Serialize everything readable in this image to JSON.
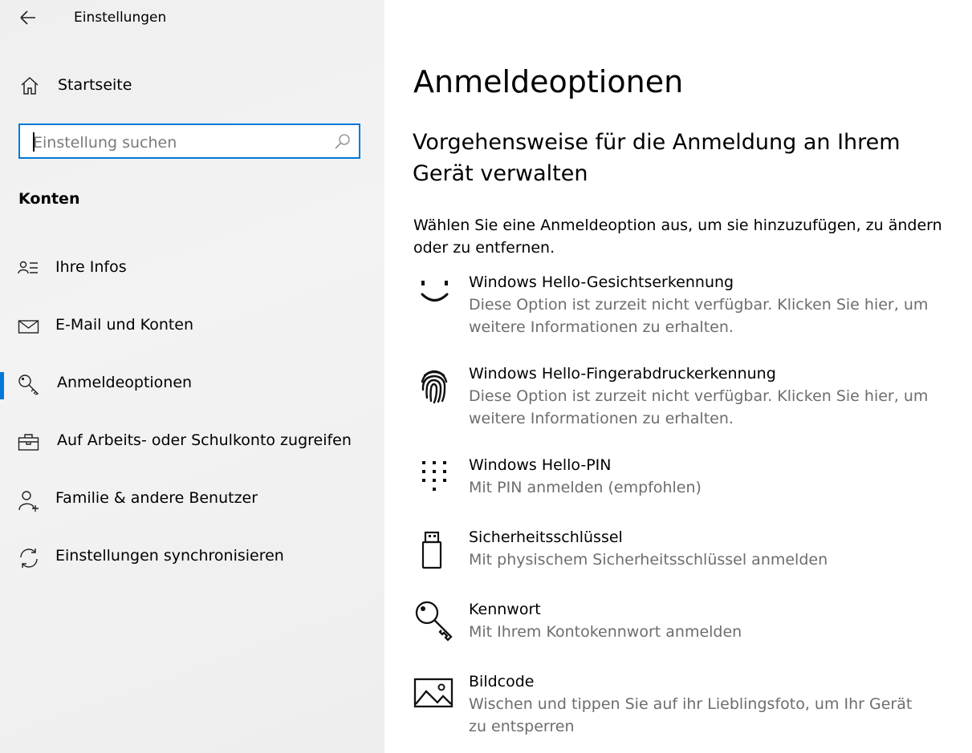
{
  "header": {
    "back_icon": "back-arrow-icon",
    "title": "Einstellungen"
  },
  "sidebar": {
    "home": {
      "icon": "home-icon",
      "label": "Startseite"
    },
    "search": {
      "placeholder": "Einstellung suchen",
      "value": "",
      "icon": "search-icon"
    },
    "section_label": "Konten",
    "items": [
      {
        "label": "Ihre Infos",
        "icon": "contact-info-icon",
        "active": false
      },
      {
        "label": "E-Mail und Konten",
        "icon": "mail-icon",
        "active": false
      },
      {
        "label": "Anmeldeoptionen",
        "icon": "key-icon",
        "active": true
      },
      {
        "label": "Auf Arbeits- oder Schulkonto zugreifen",
        "icon": "briefcase-icon",
        "active": false
      },
      {
        "label": "Familie & andere Benutzer",
        "icon": "add-user-icon",
        "active": false
      },
      {
        "label": "Einstellungen synchronisieren",
        "icon": "sync-icon",
        "active": false
      }
    ]
  },
  "main": {
    "title": "Anmeldeoptionen",
    "subtitle": "Vorgehensweise für die Anmeldung an Ihrem Gerät verwalten",
    "description": "Wählen Sie eine Anmeldeoption aus, um sie hinzuzufügen, zu ändern oder zu entfernen.",
    "options": [
      {
        "title": "Windows Hello-Gesichtserkennung",
        "desc": "Diese Option ist zurzeit nicht verfügbar. Klicken Sie hier, um weitere Informationen zu erhalten.",
        "icon": "face-icon"
      },
      {
        "title": "Windows Hello-Fingerabdruckerkennung",
        "desc": "Diese Option ist zurzeit nicht verfügbar. Klicken Sie hier, um weitere Informationen zu erhalten.",
        "icon": "fingerprint-icon"
      },
      {
        "title": "Windows Hello-PIN",
        "desc": "Mit PIN anmelden (empfohlen)",
        "icon": "pin-keypad-icon"
      },
      {
        "title": "Sicherheitsschlüssel",
        "desc": "Mit physischem Sicherheitsschlüssel anmelden",
        "icon": "usb-key-icon"
      },
      {
        "title": "Kennwort",
        "desc": "Mit Ihrem Kontokennwort anmelden",
        "icon": "password-key-icon"
      },
      {
        "title": "Bildcode",
        "desc": "Wischen und tippen Sie auf ihr Lieblingsfoto, um Ihr Gerät zu entsperren",
        "icon": "picture-icon"
      }
    ]
  },
  "colors": {
    "accent": "#0078d7",
    "sidebar_bg": "#f0f0f0",
    "secondary_text": "#6d6d6d"
  }
}
